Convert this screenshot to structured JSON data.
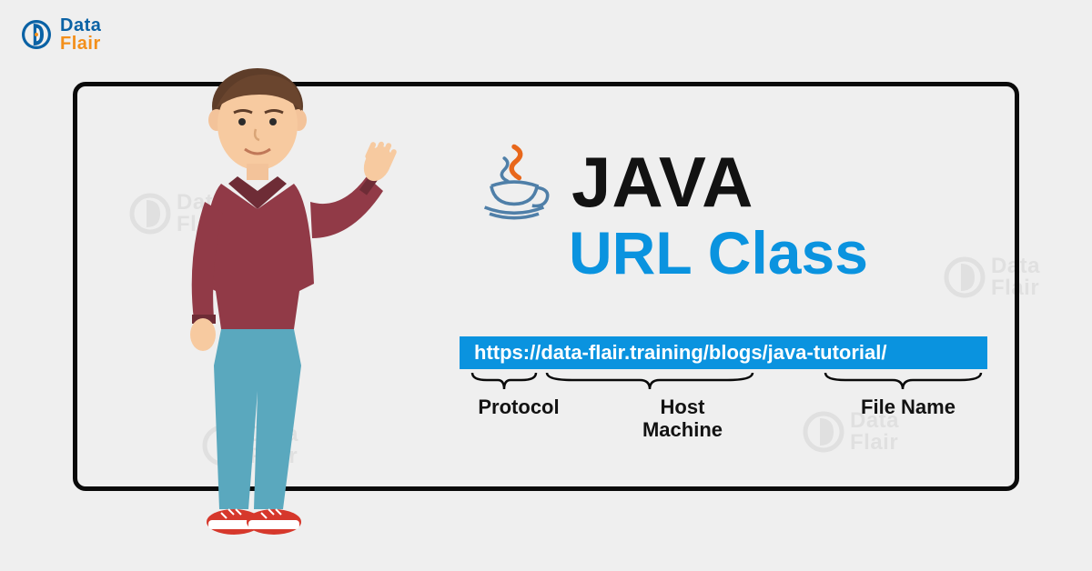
{
  "logo": {
    "line1": "Data",
    "line2": "Flair"
  },
  "title": {
    "main": "JAVA",
    "sub": "URL Class"
  },
  "url": "https://data-flair.training/blogs/java-tutorial/",
  "parts": {
    "protocol": "Protocol",
    "host": "Host\nMachine",
    "file": "File Name"
  }
}
